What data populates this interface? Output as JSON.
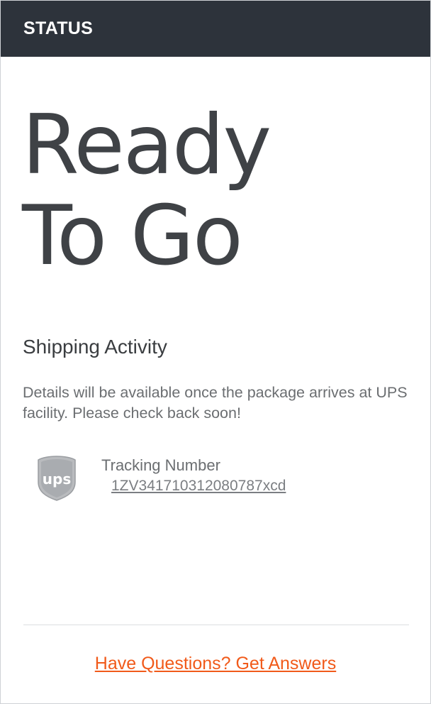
{
  "header": {
    "title": "STATUS"
  },
  "status": {
    "line1": "Ready",
    "line2": "To Go"
  },
  "shipping": {
    "title": "Shipping Activity",
    "description": "Details will be available once the package arrives at UPS facility. Please check back soon!"
  },
  "tracking": {
    "carrier_icon": "ups-logo-icon",
    "label": "Tracking Number",
    "number": "1ZV341710312080787xcd"
  },
  "footer": {
    "help_link": "Have Questions? Get Answers"
  },
  "colors": {
    "header_bg": "#2d333b",
    "link_accent": "#f15a1a",
    "text_dark": "#3f4246",
    "text_muted": "#6b6e71"
  }
}
